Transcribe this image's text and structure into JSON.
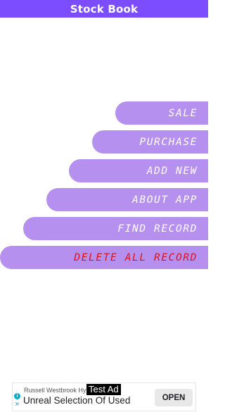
{
  "app": {
    "title": "Stock Book"
  },
  "menu": {
    "items": [
      {
        "label": "SALE"
      },
      {
        "label": "PURCHASE"
      },
      {
        "label": "ADD NEW"
      },
      {
        "label": "ABOUT APP"
      },
      {
        "label": "FIND RECORD"
      },
      {
        "label": "DELETE ALL RECORD"
      }
    ]
  },
  "ad": {
    "advertiser": "Russell Westbrook Hy",
    "test_label": "Test Ad",
    "headline": "Unreal Selection Of Used",
    "info_icon": "i",
    "close_icon": "×",
    "cta": "OPEN"
  },
  "colors": {
    "title_bar": "#7c4dff",
    "button_fill": "#b690ee",
    "button_text": "#ffffff",
    "danger_text": "#e0121b"
  }
}
